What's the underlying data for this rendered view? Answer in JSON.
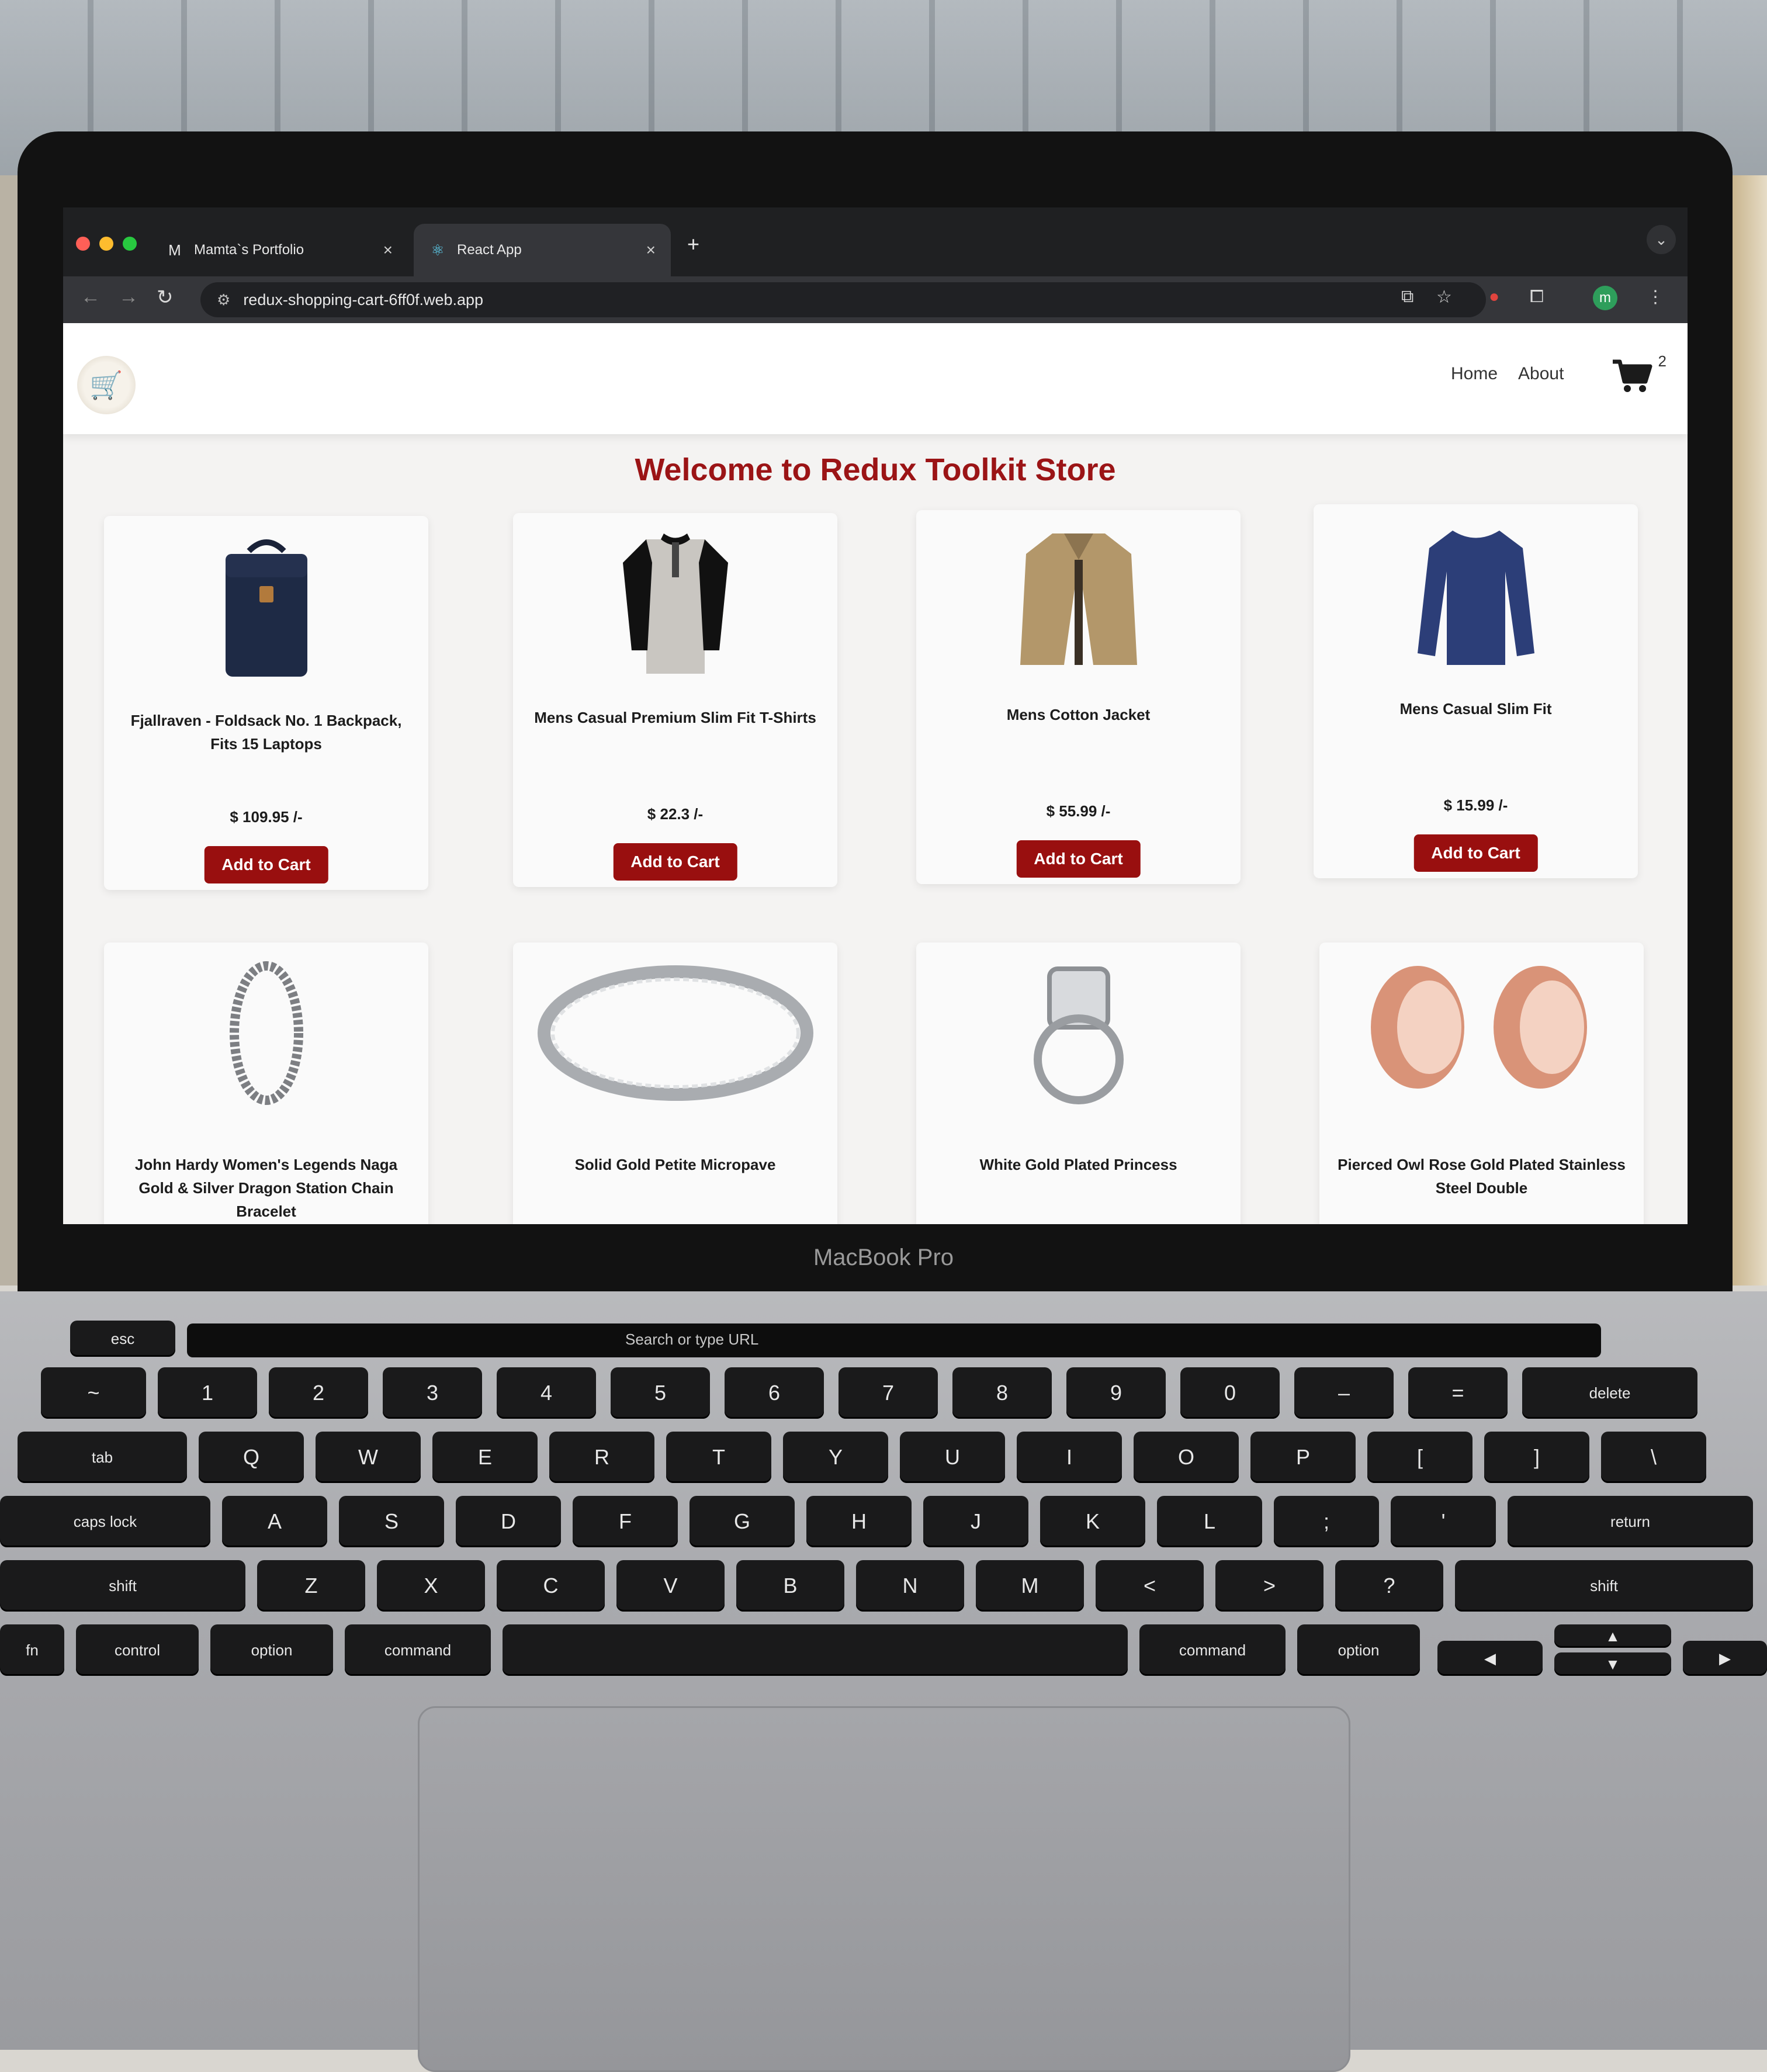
{
  "browser": {
    "tabs": [
      {
        "label": "Mamta`s Portfolio",
        "icon": "M",
        "close": "×"
      },
      {
        "label": "React App",
        "icon": "⚛",
        "close": "×"
      }
    ],
    "new_tab": "+",
    "url": "redux-shopping-cart-6ff0f.web.app",
    "profile_initial": "m"
  },
  "navbar": {
    "links": [
      "Home",
      "About"
    ],
    "cart_count": "2"
  },
  "store_title": "Welcome to Redux Toolkit Store",
  "products": [
    {
      "title": "Fjallraven - Foldsack No. 1 Backpack, Fits 15 Laptops",
      "price": "$ 109.95 /-",
      "button": "Add to Cart",
      "image": "backpack"
    },
    {
      "title": "Mens Casual Premium Slim Fit T-Shirts",
      "price": "$ 22.3 /-",
      "button": "Add to Cart",
      "image": "tshirt"
    },
    {
      "title": "Mens Cotton Jacket",
      "price": "$ 55.99 /-",
      "button": "Add to Cart",
      "image": "jacket"
    },
    {
      "title": "Mens Casual Slim Fit",
      "price": "$ 15.99 /-",
      "button": "Add to Cart",
      "image": "longsleeve"
    },
    {
      "title": "John Hardy Women's Legends Naga Gold & Silver Dragon Station Chain Bracelet",
      "image": "bracelet"
    },
    {
      "title": "Solid Gold Petite Micropave",
      "image": "ring-band"
    },
    {
      "title": "White Gold Plated Princess",
      "image": "ring-princess"
    },
    {
      "title": "Pierced Owl Rose Gold Plated Stainless Steel Double",
      "image": "tunnel-plugs"
    }
  ],
  "laptop_label": "MacBook Pro",
  "touchbar": {
    "search": "Search or type URL"
  },
  "keyboard": {
    "row0": [
      "esc"
    ],
    "row1": [
      "~",
      "1",
      "2",
      "3",
      "4",
      "5",
      "6",
      "7",
      "8",
      "9",
      "0",
      "–",
      "=",
      "delete"
    ],
    "row2": [
      "tab",
      "Q",
      "W",
      "E",
      "R",
      "T",
      "Y",
      "U",
      "I",
      "O",
      "P",
      "[",
      "]",
      "\\"
    ],
    "row3": [
      "caps lock",
      "A",
      "S",
      "D",
      "F",
      "G",
      "H",
      "J",
      "K",
      "L",
      ";",
      "'",
      "return"
    ],
    "row4": [
      "shift",
      "Z",
      "X",
      "C",
      "V",
      "B",
      "N",
      "M",
      "<",
      ">",
      "?",
      "shift"
    ],
    "row5": [
      "fn",
      "control",
      "option",
      "command",
      "",
      "command",
      "option"
    ]
  },
  "colors": {
    "accent": "#990f0f",
    "title": "#9b1416"
  }
}
